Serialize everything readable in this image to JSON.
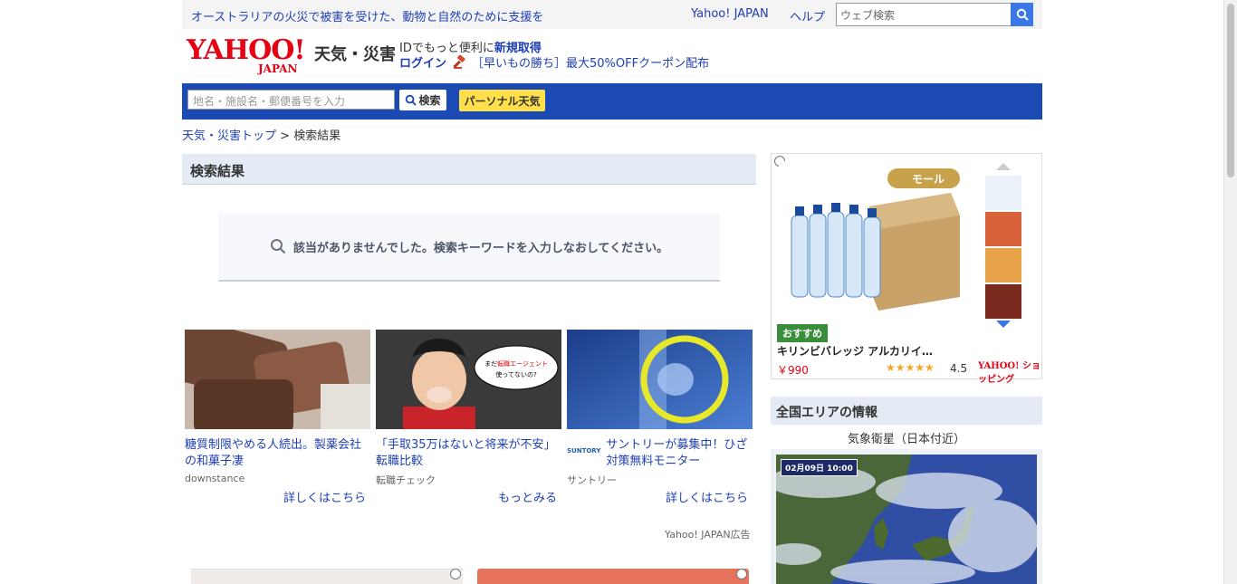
{
  "topbar": {
    "notice": "オーストラリアの火災で被害を受けた、動物と自然のために支援を",
    "yahoo_japan": "Yahoo! JAPAN",
    "help": "ヘルプ",
    "search_placeholder": "ウェブ検索"
  },
  "header": {
    "logo_text": "YAHOO!",
    "logo_sub": "JAPAN",
    "service": "天気・災害",
    "id_prefix": "IDでもっと便利に",
    "register": "新規取得",
    "login": "ログイン",
    "coupon": "［早いもの勝ち］最大50%OFFクーポン配布"
  },
  "searchbar": {
    "placeholder": "地名・施設名・郵便番号を入力",
    "search_button": "検索",
    "personal_button": "パーソナル天気"
  },
  "breadcrumb": {
    "top": "天気・災害トップ",
    "separator": ">",
    "current": "検索結果"
  },
  "main": {
    "heading": "検索結果",
    "no_result": "該当がありませんでした。検索キーワードを入力しなおしてください。"
  },
  "ads": [
    {
      "title": "糖質制限やめる人続出。製薬会社の和菓子凄",
      "source": "downstance",
      "more": "詳しくはこちら"
    },
    {
      "title": "「手取35万はないと将来が不安」転職比較",
      "source": "転職チェック",
      "more": "もっとみる",
      "bubble": "まだ転職エージェント使ってないの?"
    },
    {
      "title": "サントリーが募集中！ひざ対策無料モニター",
      "source": "サントリー",
      "more": "詳しくはこちら",
      "logo": "SUNTORY"
    }
  ],
  "ad_label": "Yahoo! JAPAN広告",
  "sidead": {
    "mall_badge": "モール",
    "recommend": "おすすめ",
    "product": "キリンビバレッジ アルカリイ…",
    "price": "￥990",
    "stars": "★★★★★",
    "rating": "4.5",
    "shopping_logo": "YAHOO! ショッピング"
  },
  "area": {
    "heading": "全国エリアの情報",
    "satellite_label": "気象衛星（日本付近）",
    "timestamp": "02月09日 10:00"
  }
}
